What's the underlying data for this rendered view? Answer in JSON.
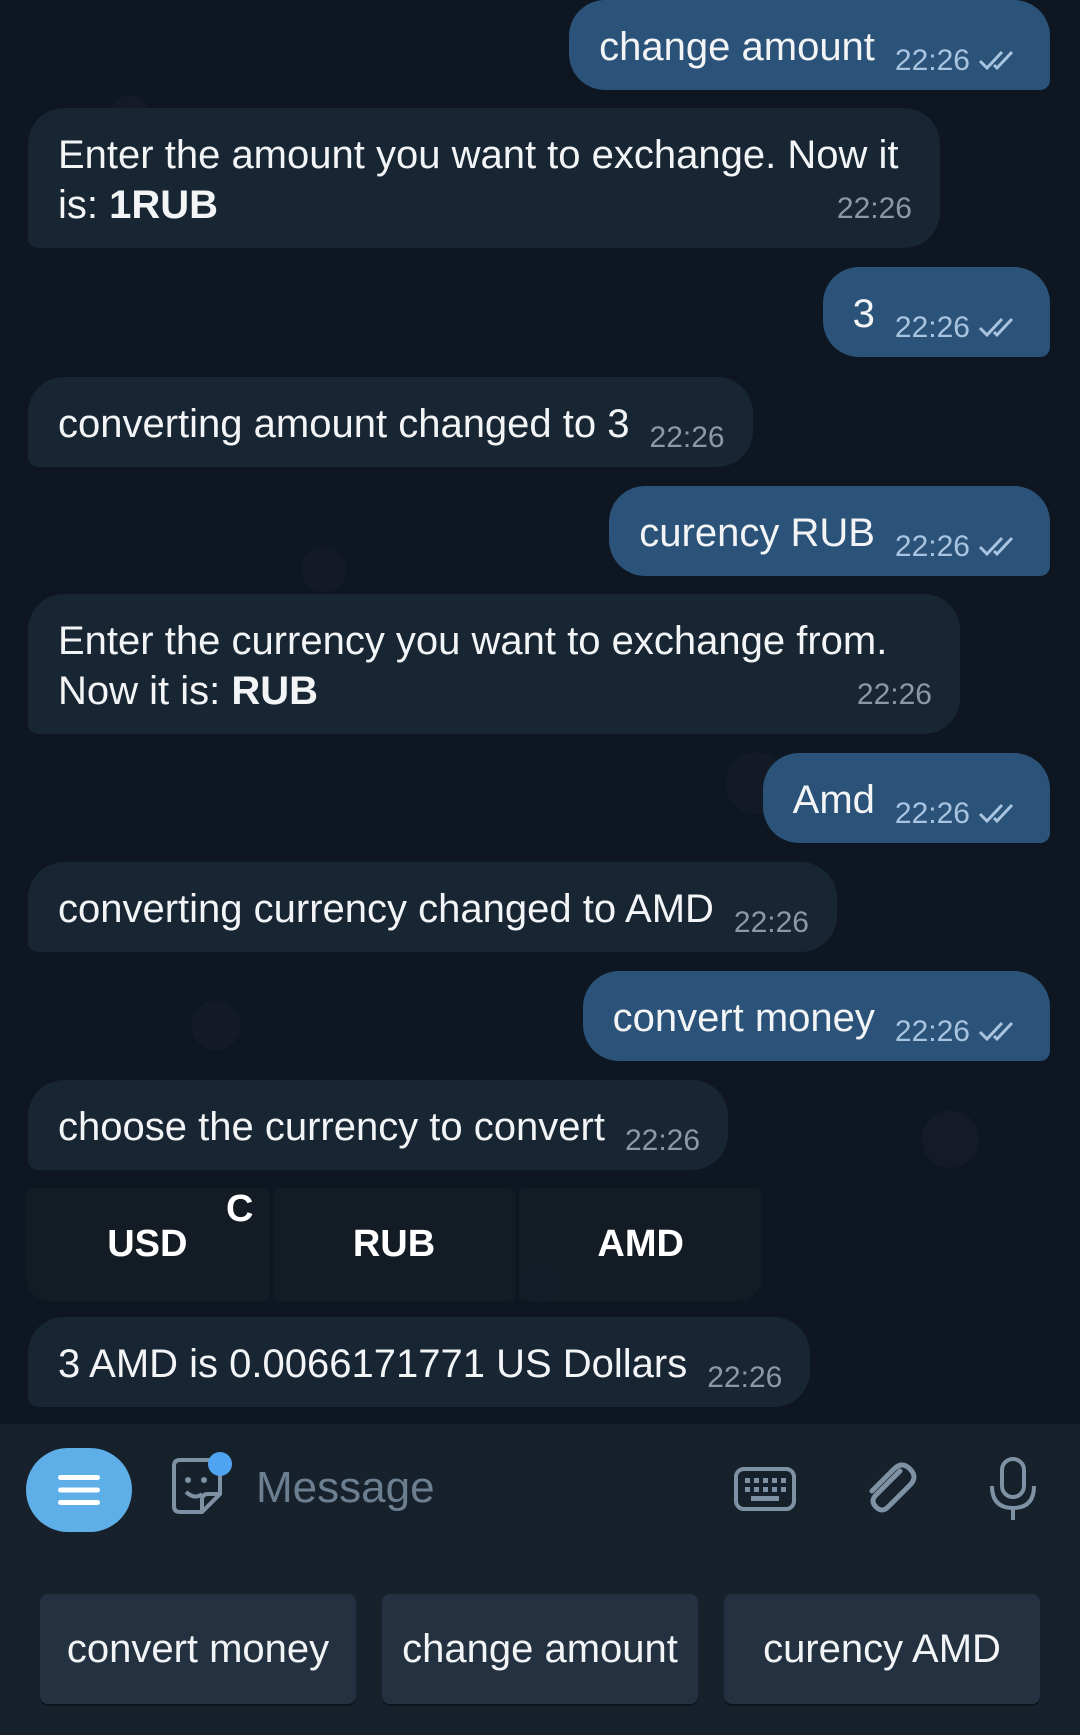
{
  "messages": [
    {
      "text": "change amount",
      "time": "22:26"
    },
    {
      "text_prefix": "Enter the amount you want to exchange. Now it is: ",
      "text_bold": "1RUB",
      "time": "22:26"
    },
    {
      "text": "3",
      "time": "22:26"
    },
    {
      "text": "converting amount changed to 3",
      "time": "22:26"
    },
    {
      "text": "curency RUB",
      "time": "22:26"
    },
    {
      "text_prefix": "Enter the currency you want to exchange from. Now it is: ",
      "text_bold": "RUB",
      "time": "22:26"
    },
    {
      "text": "Amd",
      "time": "22:26"
    },
    {
      "text": "converting currency changed to AMD",
      "time": "22:26"
    },
    {
      "text": "convert money",
      "time": "22:26"
    },
    {
      "text": "choose the currency to convert",
      "time": "22:26"
    },
    {
      "text": "3 AMD is 0.0066171771 US Dollars",
      "time": "22:26"
    }
  ],
  "inline_keyboard": {
    "buttons": [
      "USD",
      "RUB",
      "AMD"
    ],
    "stray_char": "C"
  },
  "input_bar": {
    "placeholder": "Message"
  },
  "reply_keyboard": {
    "buttons": [
      "convert money",
      "change amount",
      "curency AMD"
    ]
  },
  "colors": {
    "outgoing_bubble": "#2b5278",
    "incoming_bubble": "#182533",
    "menu_button": "#5eaee8",
    "background": "#0e1621"
  }
}
